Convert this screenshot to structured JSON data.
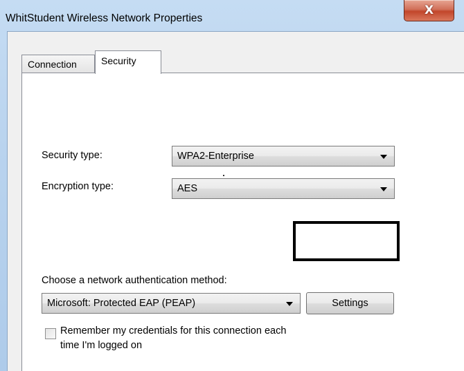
{
  "window": {
    "title": "WhitStudent Wireless Network Properties",
    "close_glyph": "X"
  },
  "tabs": [
    {
      "label": "Connection",
      "selected": false
    },
    {
      "label": "Security",
      "selected": true
    }
  ],
  "security_type": {
    "label": "Security type:",
    "value": "WPA2-Enterprise"
  },
  "encryption_type": {
    "label": "Encryption type:",
    "value": "AES"
  },
  "auth_method": {
    "label": "Choose a network authentication method:",
    "value": "Microsoft: Protected EAP (PEAP)",
    "settings_label": "Settings"
  },
  "remember_credentials": {
    "label_line1": "Remember my credentials for this connection each",
    "label_line2": "time I'm logged on",
    "checked": false
  },
  "icons": {
    "close": "close-icon",
    "dropdown": "chevron-down-icon"
  }
}
